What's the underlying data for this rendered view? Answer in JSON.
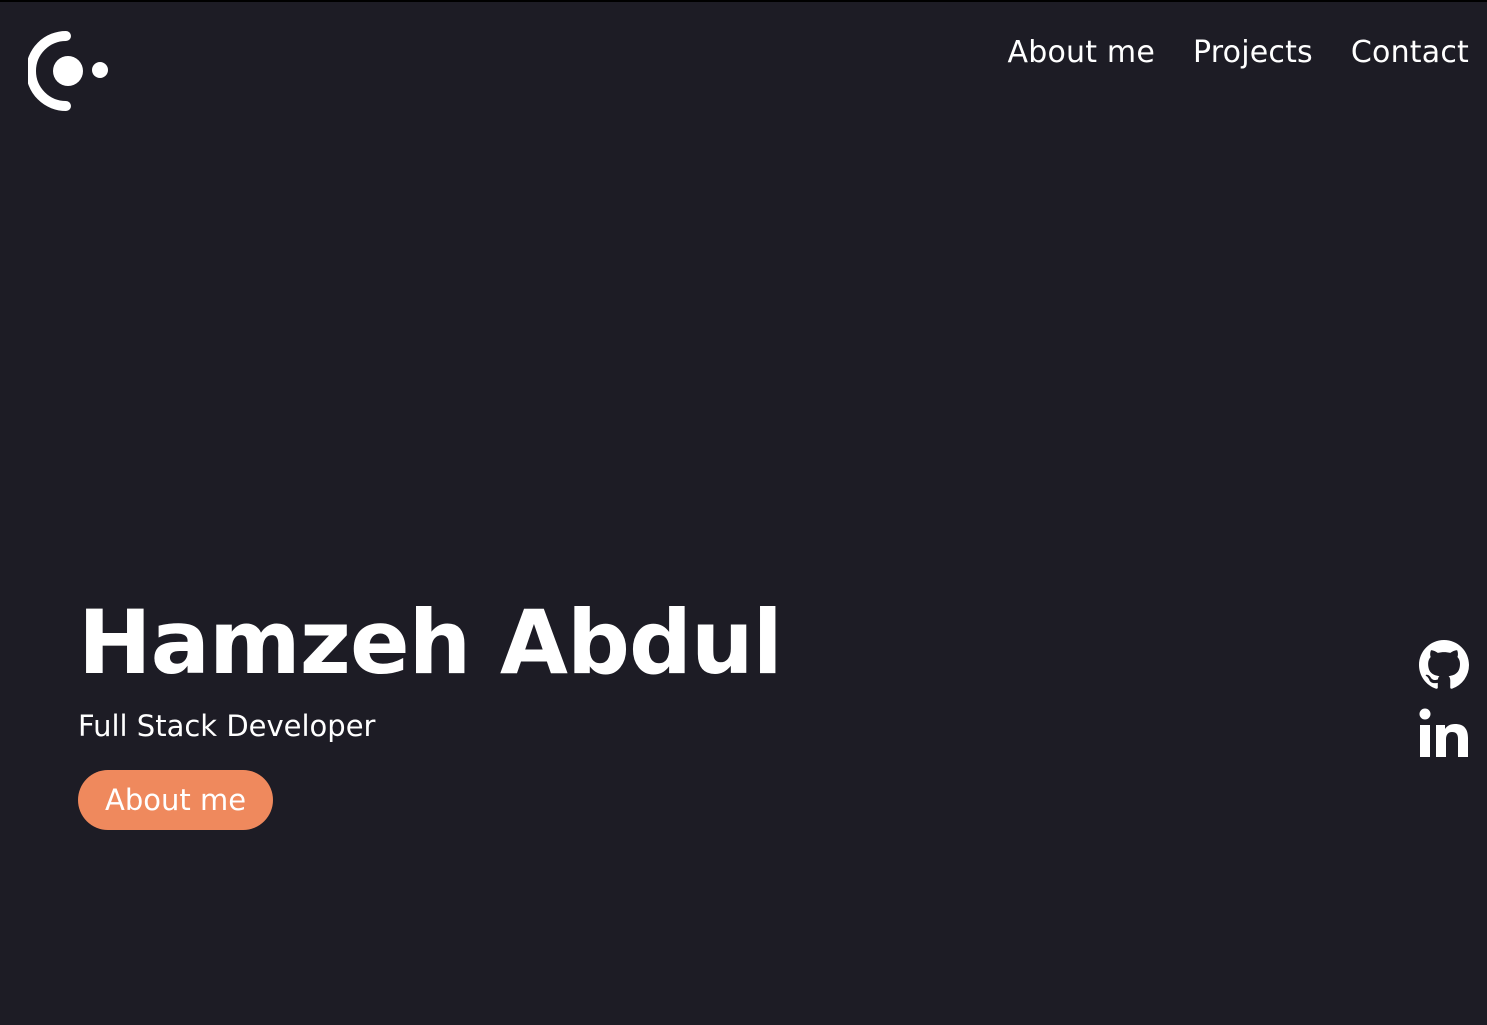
{
  "colors": {
    "background": "#1d1c25",
    "text": "#ffffff",
    "accent": "#ef895d"
  },
  "header": {
    "logo_icon": "brand-logo-icon",
    "nav": [
      {
        "label": "About me"
      },
      {
        "label": "Projects"
      },
      {
        "label": "Contact"
      }
    ]
  },
  "hero": {
    "name": "Hamzeh Abdul",
    "role": "Full Stack Developer",
    "cta_label": "About me"
  },
  "social": {
    "github_icon": "github-icon",
    "linkedin_icon": "linkedin-icon"
  }
}
